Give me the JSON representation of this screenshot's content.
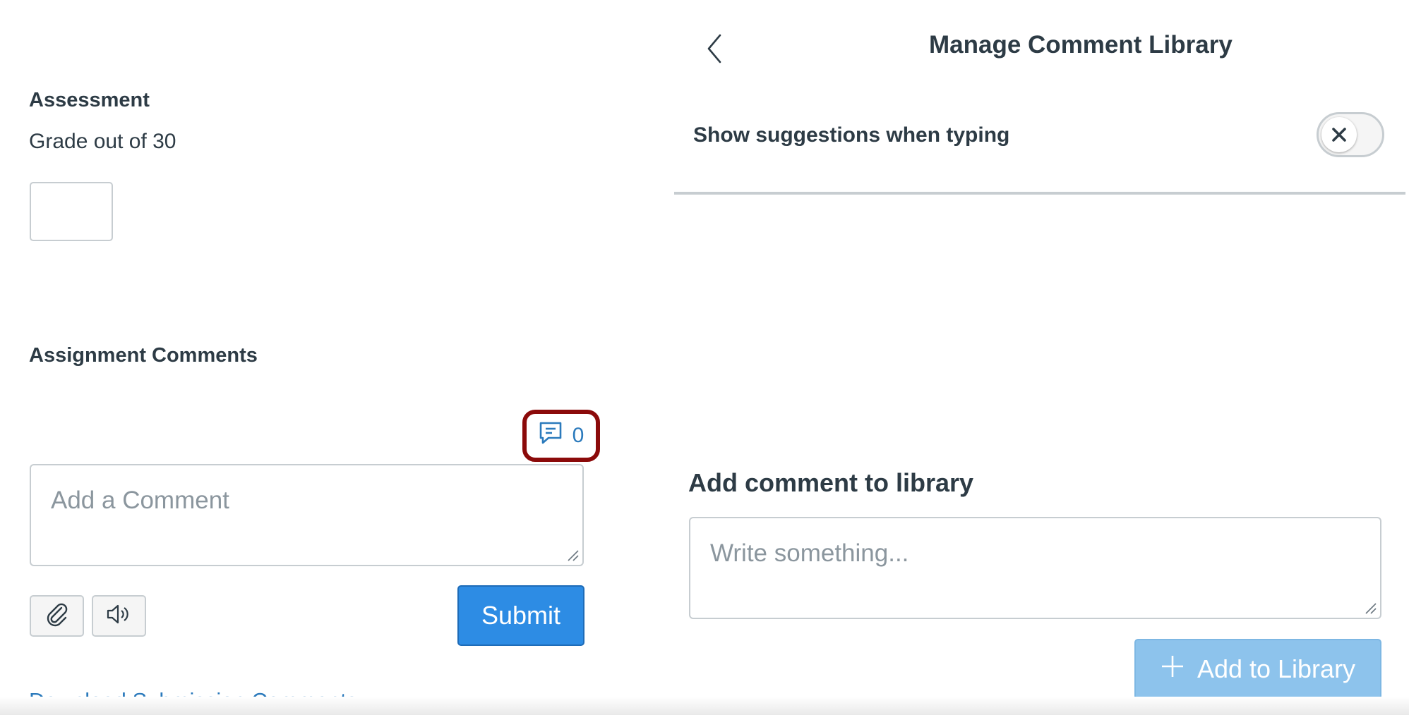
{
  "assessment": {
    "heading": "Assessment",
    "grade_label": "Grade out of 30",
    "grade_value": ""
  },
  "comments": {
    "heading": "Assignment Comments",
    "library_count": "0",
    "placeholder": "Add a Comment",
    "submit_label": "Submit",
    "download_link": "Download Submission Comments"
  },
  "library": {
    "title": "Manage Comment Library",
    "suggestions_label": "Show suggestions when typing",
    "suggestions_enabled": false,
    "add_heading": "Add comment to library",
    "placeholder": "Write something...",
    "add_button_label": "Add to Library"
  },
  "colors": {
    "text": "#2d3b45",
    "link": "#2b7abc",
    "primary": "#2d8ce4",
    "primary_disabled": "#8dc3ec",
    "highlight": "#8b0a0a",
    "border": "#c7cdd1"
  },
  "icons": {
    "library": "comment-library-icon",
    "attach": "paperclip-icon",
    "media": "speaker-icon",
    "back": "chevron-left-icon",
    "toggle": "x-icon",
    "add": "plus-icon"
  }
}
